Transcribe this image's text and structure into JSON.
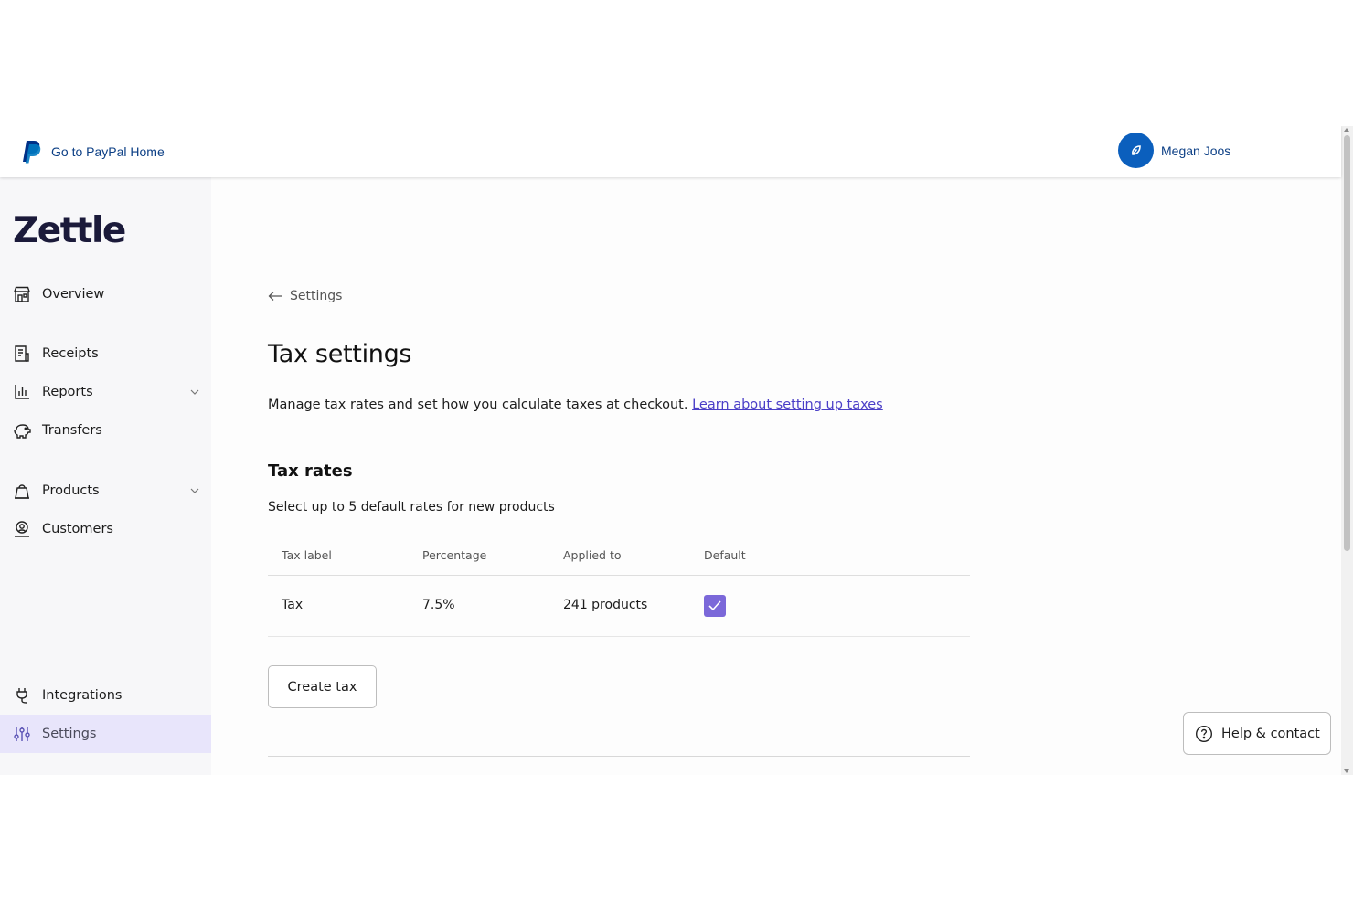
{
  "topbar": {
    "home_link": "Go to PayPal Home",
    "user_name": "Megan Joos"
  },
  "sidebar": {
    "brand": "Zettle",
    "items": [
      {
        "label": "Overview",
        "icon": "storefront-icon"
      },
      {
        "label": "Receipts",
        "icon": "receipt-icon"
      },
      {
        "label": "Reports",
        "icon": "bar-chart-icon",
        "expandable": true
      },
      {
        "label": "Transfers",
        "icon": "piggy-bank-icon"
      },
      {
        "label": "Products",
        "icon": "shopping-bag-icon",
        "expandable": true
      },
      {
        "label": "Customers",
        "icon": "customers-icon"
      },
      {
        "label": "Integrations",
        "icon": "plug-icon"
      },
      {
        "label": "Settings",
        "icon": "sliders-icon",
        "active": true
      }
    ]
  },
  "main": {
    "breadcrumb": "Settings",
    "title": "Tax settings",
    "description": "Manage tax rates and set how you calculate taxes at checkout.",
    "learn_link": "Learn about setting up taxes",
    "section_title": "Tax rates",
    "section_subtitle": "Select up to 5 default rates for new products",
    "table": {
      "headers": [
        "Tax label",
        "Percentage",
        "Applied to",
        "Default"
      ],
      "rows": [
        {
          "label": "Tax",
          "percentage": "7.5%",
          "applied_to": "241 products",
          "default": true
        }
      ]
    },
    "create_button": "Create tax"
  },
  "help_button": "Help & contact",
  "colors": {
    "accent": "#7b68d9",
    "active_nav": "#e8e5fb",
    "paypal_blue": "#0c3f85",
    "avatar": "#0b5fbd",
    "link": "#4a3ec7"
  }
}
